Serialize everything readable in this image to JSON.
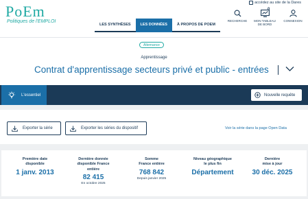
{
  "header": {
    "logo_main": "PoEm",
    "logo_line1": "Politiques de l'EMPLOI",
    "access_link": "accédez au site de la Dares",
    "nav": [
      {
        "label": "LES SYNTHÈSES"
      },
      {
        "label": "LES DONNÉES"
      },
      {
        "label": "À PROPOS DE POEM"
      }
    ],
    "tools": {
      "search": "RECHERCHE",
      "dashboard_line1": "MON TABLEAU",
      "dashboard_line2": "DE BORD",
      "dashboard_badge": "0",
      "login": "CONNEXION"
    }
  },
  "banner": {
    "pill": "Alternance",
    "category": "Apprentissage",
    "title": "Contrat d'apprentissage secteurs privé et public - entrées"
  },
  "tabbar": {
    "tab": "L'essentiel",
    "new_query": "Nouvelle requête"
  },
  "export": {
    "export_series": "Exporter la série",
    "export_device": "Exporter les séries du dispositif",
    "open_data_link": "Voir la série dans la page Open Data"
  },
  "stats": [
    {
      "label_l1": "Première date",
      "label_l2": "disponible",
      "label_l3": "",
      "value": "1 janv. 2013",
      "note": ""
    },
    {
      "label_l1": "Dernière donnée",
      "label_l2": "disponible France",
      "label_l3": "entière",
      "value": "82 415",
      "note": "En octobre 2025"
    },
    {
      "label_l1": "Somme",
      "label_l2": "France entière",
      "label_l3": "",
      "value": "768 842",
      "note": "Depuis janvier 2025"
    },
    {
      "label_l1": "Niveau géographique",
      "label_l2": "le plus fin",
      "label_l3": "",
      "value": "Département",
      "note": ""
    },
    {
      "label_l1": "Dernière",
      "label_l2": "mise à jour",
      "label_l3": "",
      "value": "30 déc. 2025",
      "note": ""
    }
  ],
  "colors": {
    "accent": "#1b6fa8",
    "teal": "#1fa9a3",
    "navy": "#1b3a57"
  }
}
